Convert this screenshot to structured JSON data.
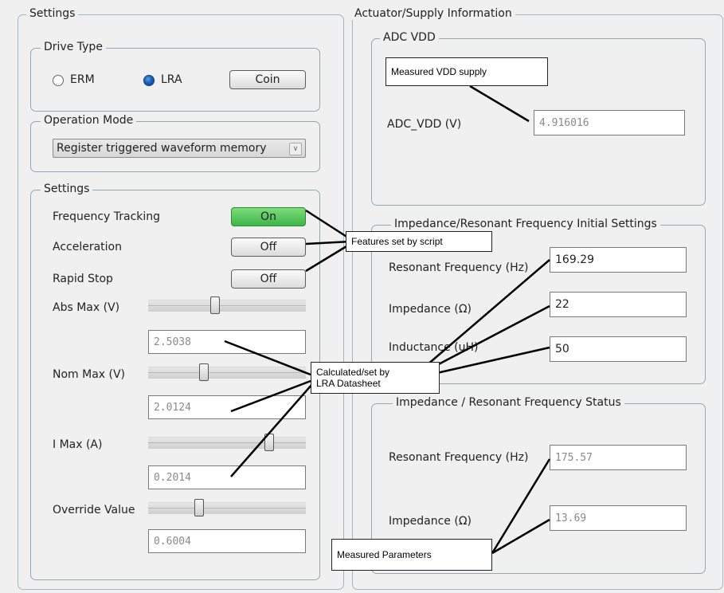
{
  "settings_title": "Settings",
  "drive_type": {
    "title": "Drive Type",
    "erm_label": "ERM",
    "lra_label": "LRA",
    "coin_label": "Coin"
  },
  "operation_mode": {
    "title": "Operation Mode",
    "selected": "Register triggered waveform memory"
  },
  "inner_settings": {
    "title": "Settings",
    "frequency_tracking_label": "Frequency Tracking",
    "frequency_tracking_value": "On",
    "acceleration_label": "Acceleration",
    "acceleration_value": "Off",
    "rapid_stop_label": "Rapid Stop",
    "rapid_stop_value": "Off",
    "abs_max_label": "Abs Max (V)",
    "abs_max_value": "2.5038",
    "nom_max_label": "Nom Max (V)",
    "nom_max_value": "2.0124",
    "i_max_label": "I Max (A)",
    "i_max_value": "0.2014",
    "override_label": "Override Value",
    "override_value": "0.6004"
  },
  "actuator": {
    "title": "Actuator/Supply Information",
    "adc_vdd_title": "ADC VDD",
    "adc_vdd_label": "ADC_VDD (V)",
    "adc_vdd_value": "4.916016"
  },
  "impedance_init": {
    "title": "Impedance/Resonant Frequency Initial Settings",
    "resonant_label": "Resonant Frequency (Hz)",
    "resonant_value": "169.29",
    "impedance_label": "Impedance (Ω)",
    "impedance_value": "22",
    "inductance_label": "Inductance (uH)",
    "inductance_value": "50"
  },
  "impedance_status": {
    "title": "Impedance / Resonant Frequency Status",
    "resonant_label": "Resonant Frequency (Hz)",
    "resonant_value": "175.57",
    "impedance_label": "Impedance (Ω)",
    "impedance_value": "13.69"
  },
  "callouts": {
    "vdd": "Measured VDD supply",
    "features": "Features set by script",
    "lra_line1": "Calculated/set by",
    "lra_line2": "LRA Datasheet",
    "measured": "Measured Parameters"
  },
  "icons": {
    "dropdown": "chevron-down-icon",
    "radio_selected": "radio-selected-icon"
  },
  "colors": {
    "on_button": "#3cb54a",
    "radio_selected": "#1e5fb5"
  }
}
